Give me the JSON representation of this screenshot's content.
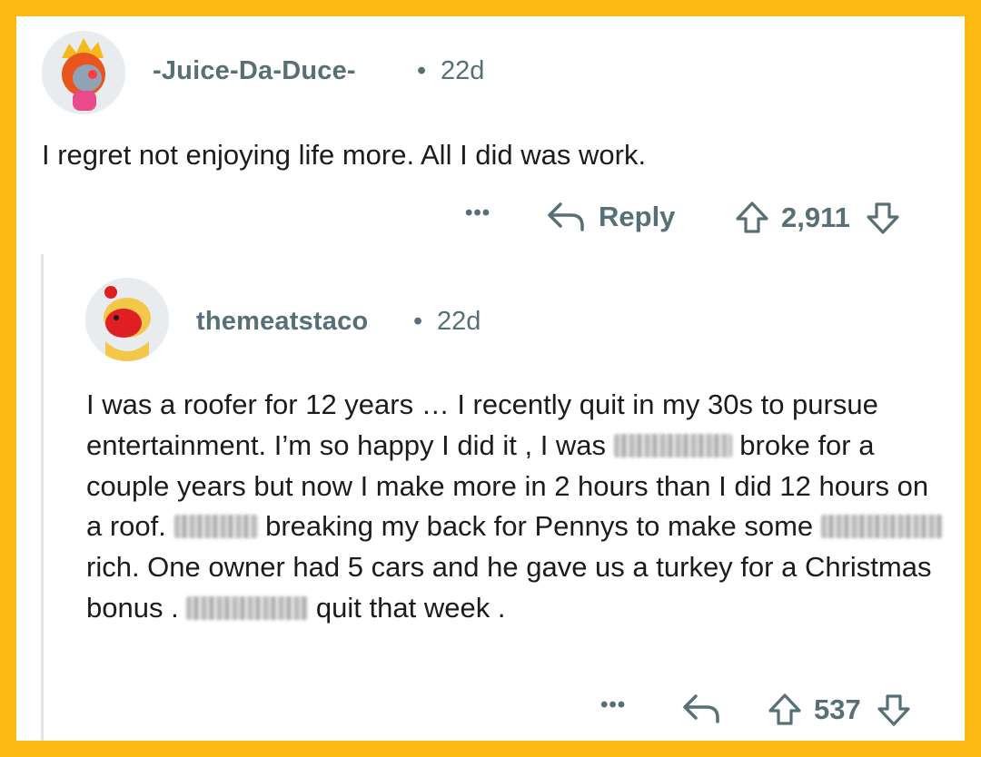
{
  "colors": {
    "frame": "#FDB812",
    "card": "#ffffff",
    "meta_text": "#576f76",
    "body_text": "#1c1c1c"
  },
  "comment1": {
    "username": "-Juice-Da-Duce-",
    "separator": "•",
    "age": "22d",
    "text": "I regret not enjoying life more. All I did was work.",
    "more_label": "•••",
    "reply_label": "Reply",
    "score": "2,911"
  },
  "comment2": {
    "username": "themeatstaco",
    "separator": "•",
    "age": "22d",
    "text_segments": [
      "I was a roofer for 12 years … I recently quit in my 30s to pursue entertainment. I’m so happy I did it , I was ",
      " broke for a couple years but now I make more in 2 hours than I did 12 hours on a roof. ",
      " breaking my back for Pennys to make some ",
      " rich. One owner had 5 cars and he gave us a turkey for a Christmas bonus . ",
      " quit that week ."
    ],
    "more_label": "•••",
    "score": "537"
  }
}
